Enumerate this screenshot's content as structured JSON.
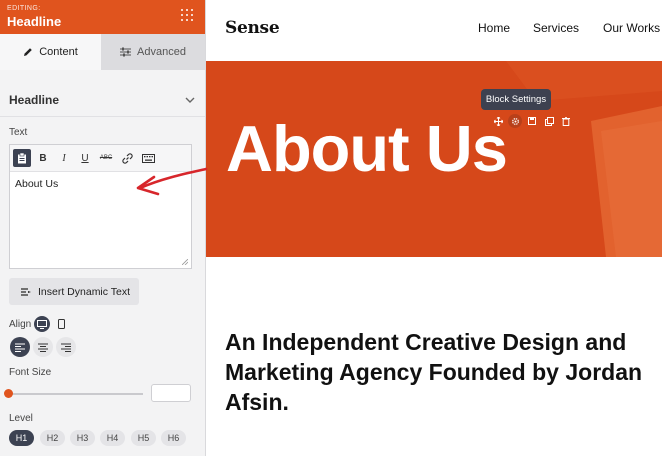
{
  "sidebar": {
    "editing_label": "EDITING:",
    "title": "Headline",
    "tabs": [
      {
        "label": "Content",
        "icon": "pencil-icon",
        "active": true
      },
      {
        "label": "Advanced",
        "icon": "sliders-icon",
        "active": false
      }
    ],
    "section_title": "Headline",
    "text_label": "Text",
    "editor_value": "About Us",
    "toolbar_buttons": [
      {
        "label": "",
        "icon": "paste-icon"
      },
      {
        "label": "B",
        "icon": "bold-icon"
      },
      {
        "label": "I",
        "icon": "italic-icon"
      },
      {
        "label": "U",
        "icon": "underline-icon"
      },
      {
        "label": "ABC",
        "icon": "strikethrough-icon"
      },
      {
        "label": "",
        "icon": "link-icon"
      },
      {
        "label": "",
        "icon": "keyboard-icon"
      }
    ],
    "dynamic_text_button": "Insert Dynamic Text",
    "align_label": "Align",
    "font_size_label": "Font Size",
    "font_size_value": "",
    "font_size_slider_level": 0,
    "level_label": "Level",
    "levels": [
      "H1",
      "H2",
      "H3",
      "H4",
      "H5",
      "H6"
    ],
    "active_level": "H1",
    "accent_color": "#e0541e",
    "active_button_color": "#3c4252"
  },
  "preview": {
    "logo": "Sense",
    "nav": [
      "Home",
      "Services",
      "Our Works"
    ],
    "hero_heading": "About Us",
    "hero_color": "#d6481a",
    "tooltip": "Block Settings",
    "block_tools": [
      "move-icon",
      "settings-icon",
      "save-icon",
      "duplicate-icon",
      "delete-icon"
    ],
    "body_text": "An Independent Creative Design and Marketing Agency Founded by Jordan Afsin."
  }
}
